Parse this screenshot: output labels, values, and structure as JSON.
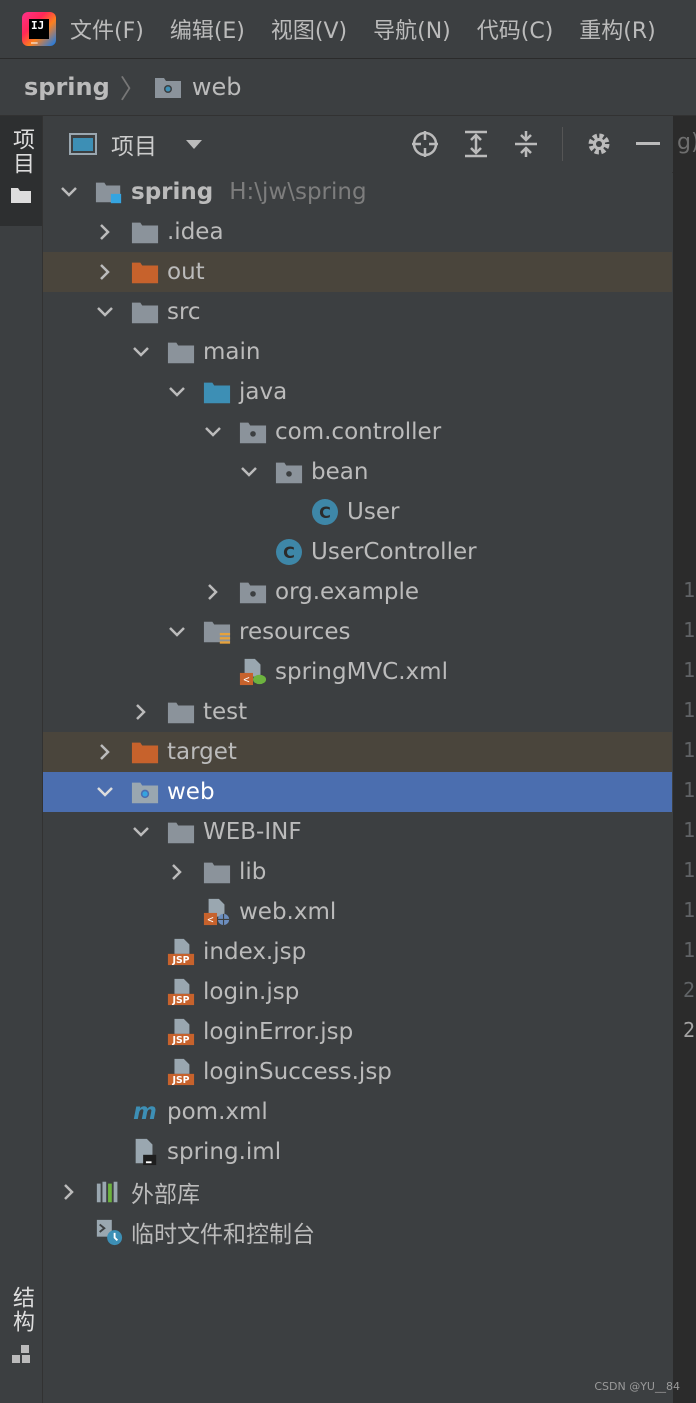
{
  "menubar": {
    "items": [
      "文件(F)",
      "编辑(E)",
      "视图(V)",
      "导航(N)",
      "代码(C)",
      "重构(R)"
    ]
  },
  "breadcrumb": {
    "root": "spring",
    "current": "web"
  },
  "side_tabs": {
    "project": "项目",
    "structure": "结构"
  },
  "toolbar": {
    "title": "项目"
  },
  "tree": {
    "root_name": "spring",
    "root_path": "H:\\jw\\spring",
    "nodes": [
      ".idea",
      "out",
      "src",
      "main",
      "java",
      "com.controller",
      "bean",
      "User",
      "UserController",
      "org.example",
      "resources",
      "springMVC.xml",
      "test",
      "target",
      "web",
      "WEB-INF",
      "lib",
      "web.xml",
      "index.jsp",
      "login.jsp",
      "loginError.jsp",
      "loginSuccess.jsp",
      "pom.xml",
      "spring.iml"
    ],
    "external_libs": "外部库",
    "scratches": "临时文件和控制台"
  },
  "gutter": {
    "fragment": "g)",
    "numbers": [
      "1",
      "1",
      "1",
      "1",
      "1",
      "1",
      "1",
      "1",
      "1",
      "1",
      "2",
      "2"
    ]
  },
  "watermark": "CSDN @YU__84",
  "colors": {
    "background": "#3c3f41",
    "selection": "#4b6eaf",
    "excluded": "#4a453c",
    "folder": "#8b939b",
    "source_folder": "#3d8fb5",
    "excluded_folder": "#c7622c",
    "class_icon": "#3e87a8"
  }
}
